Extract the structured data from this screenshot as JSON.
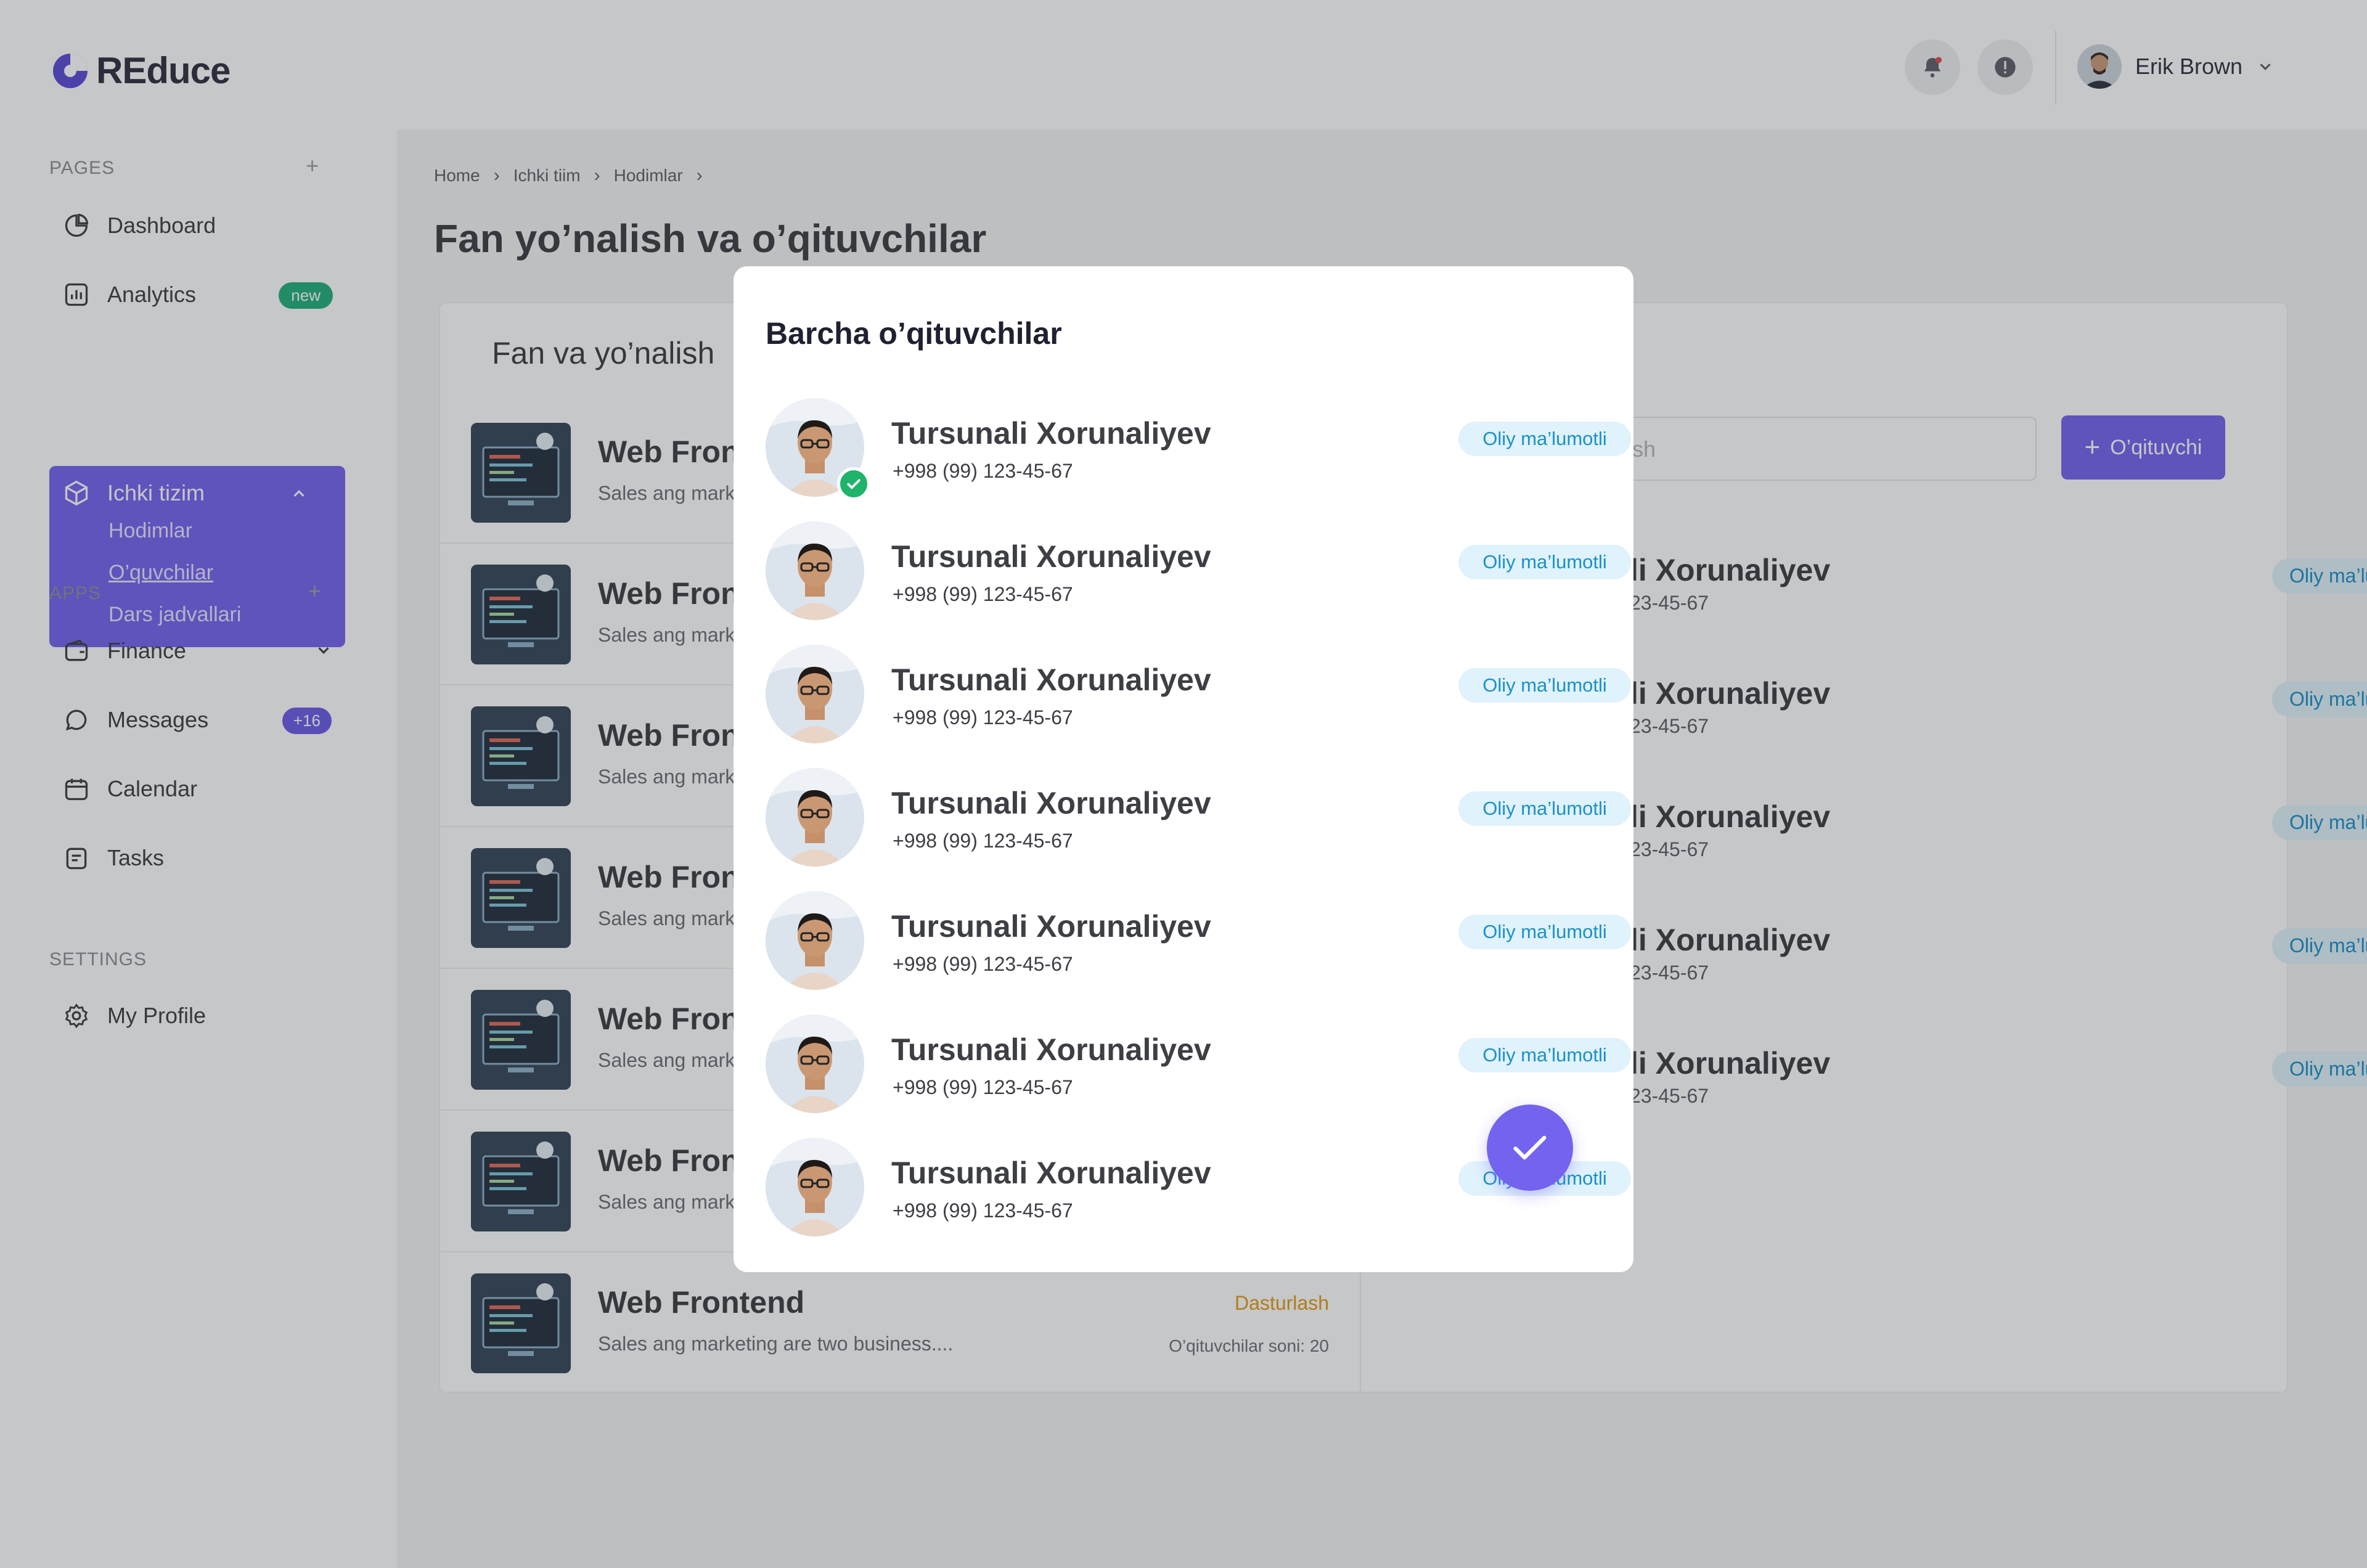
{
  "app": {
    "logo_text": "REduce",
    "user_name": "Erik Brown",
    "accent": "#7463ef"
  },
  "sidebar": {
    "pages_label": "PAGES",
    "apps_label": "APPS",
    "settings_label": "SETTINGS",
    "items": [
      {
        "label": "Dashboard",
        "icon": "pie-chart-icon"
      },
      {
        "label": "Analytics",
        "icon": "bar-chart-icon",
        "badge": "new"
      },
      {
        "label": "Ichki tizim",
        "icon": "cube-icon",
        "subitems": [
          "Hodimlar",
          "O’quvchilar",
          "Dars jadvallari"
        ]
      },
      {
        "label": "Finance",
        "icon": "wallet-icon"
      },
      {
        "label": "Messages",
        "icon": "chat-icon",
        "badge": "+16"
      },
      {
        "label": "Calendar",
        "icon": "calendar-icon"
      },
      {
        "label": "Tasks",
        "icon": "tasks-icon"
      },
      {
        "label": "My Profile",
        "icon": "gear-icon"
      }
    ]
  },
  "breadcrumb": [
    "Home",
    "Ichki tiim",
    "Hodimlar"
  ],
  "page_title": "Fan yo’nalish va o’qituvchilar",
  "courses_panel": {
    "title": "Fan va yo’nalish",
    "visible_title": "Web Fron",
    "visible_sub": "Sales ang mark",
    "last_course": {
      "title": "Web Frontend",
      "subtitle": "Sales ang marketing are two business....",
      "tag": "Dasturlash",
      "count": "O’qituvchilar soni: 20"
    }
  },
  "teachers_panel": {
    "search_placeholder": "a qidirish",
    "add_button": "O’qituvchi",
    "rows": [
      {
        "name": "li Xorunaliyev",
        "phone": "23-45-67",
        "tag": "Oliy ma’lumotli"
      },
      {
        "name": "li Xorunaliyev",
        "phone": "23-45-67",
        "tag": "Oliy ma’lumotli"
      },
      {
        "name": "li Xorunaliyev",
        "phone": "23-45-67",
        "tag": "Oliy ma’lumotli"
      },
      {
        "name": "li Xorunaliyev",
        "phone": "23-45-67",
        "tag": "Oliy ma’lumotli"
      },
      {
        "name": "li Xorunaliyev",
        "phone": "23-45-67",
        "tag": "Oliy ma’lumotli"
      }
    ]
  },
  "modal": {
    "title": "Barcha o’qituvchilar",
    "teachers": [
      {
        "name": "Tursunali Xorunaliyev",
        "phone": "+998 (99) 123-45-67",
        "tag": "Oliy ma’lumotli",
        "selected": true
      },
      {
        "name": "Tursunali Xorunaliyev",
        "phone": "+998 (99) 123-45-67",
        "tag": "Oliy ma’lumotli",
        "selected": false
      },
      {
        "name": "Tursunali Xorunaliyev",
        "phone": "+998 (99) 123-45-67",
        "tag": "Oliy ma’lumotli",
        "selected": false
      },
      {
        "name": "Tursunali Xorunaliyev",
        "phone": "+998 (99) 123-45-67",
        "tag": "Oliy ma’lumotli",
        "selected": false
      },
      {
        "name": "Tursunali Xorunaliyev",
        "phone": "+998 (99) 123-45-67",
        "tag": "Oliy ma’lumotli",
        "selected": false
      },
      {
        "name": "Tursunali Xorunaliyev",
        "phone": "+998 (99) 123-45-67",
        "tag": "Oliy ma’lumotli",
        "selected": false
      },
      {
        "name": "Tursunali Xorunaliyev",
        "phone": "+998 (99) 123-45-67",
        "tag": "Oliy ma’lumotli",
        "selected": false
      }
    ]
  }
}
